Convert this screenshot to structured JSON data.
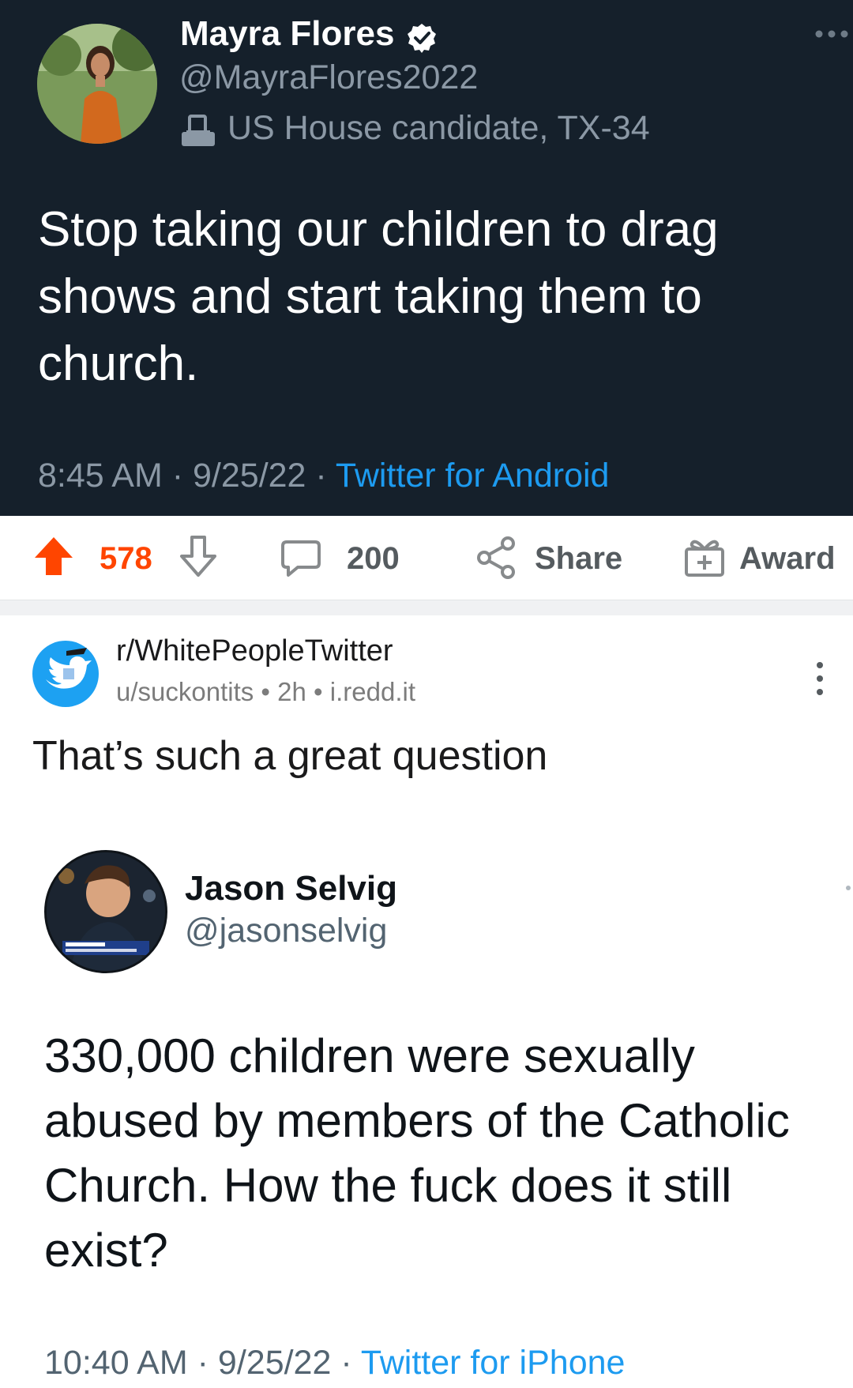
{
  "colors": {
    "tweet_dark_bg": "#15202b",
    "upvote_orange": "#ff4500",
    "twitter_blue": "#1d9bf0",
    "muted_gray": "#8b98a5"
  },
  "tweet1": {
    "name": "Mayra Flores",
    "verified_icon": "verified-badge-icon",
    "handle": "@MayraFlores2022",
    "label_icon": "ballot-box-icon",
    "label": "US House candidate, TX-34",
    "text": "Stop taking our children to drag shows and start taking them to church.",
    "time": "8:45 AM",
    "sep": "·",
    "date": "9/25/22",
    "source": "Twitter for Android"
  },
  "actions": {
    "upvote_icon": "upvote-arrow-icon",
    "score": "578",
    "downvote_icon": "downvote-arrow-icon",
    "comment_icon": "comment-bubble-icon",
    "comments": "200",
    "share_icon": "share-icon",
    "share": "Share",
    "award_icon": "award-gift-icon",
    "award": "Award"
  },
  "post": {
    "subreddit": "r/WhitePeopleTwitter",
    "user": "u/suckontits",
    "bullet": "•",
    "age": "2h",
    "domain": "i.redd.it",
    "title": "That’s such a great question"
  },
  "tweet2": {
    "name": "Jason Selvig",
    "handle": "@jasonselvig",
    "text": "330,000 children were sexually abused by members of the Catholic Church. How the fuck does it still exist?",
    "time": "10:40 AM",
    "sep": "·",
    "date": "9/25/22",
    "source": "Twitter for iPhone"
  }
}
